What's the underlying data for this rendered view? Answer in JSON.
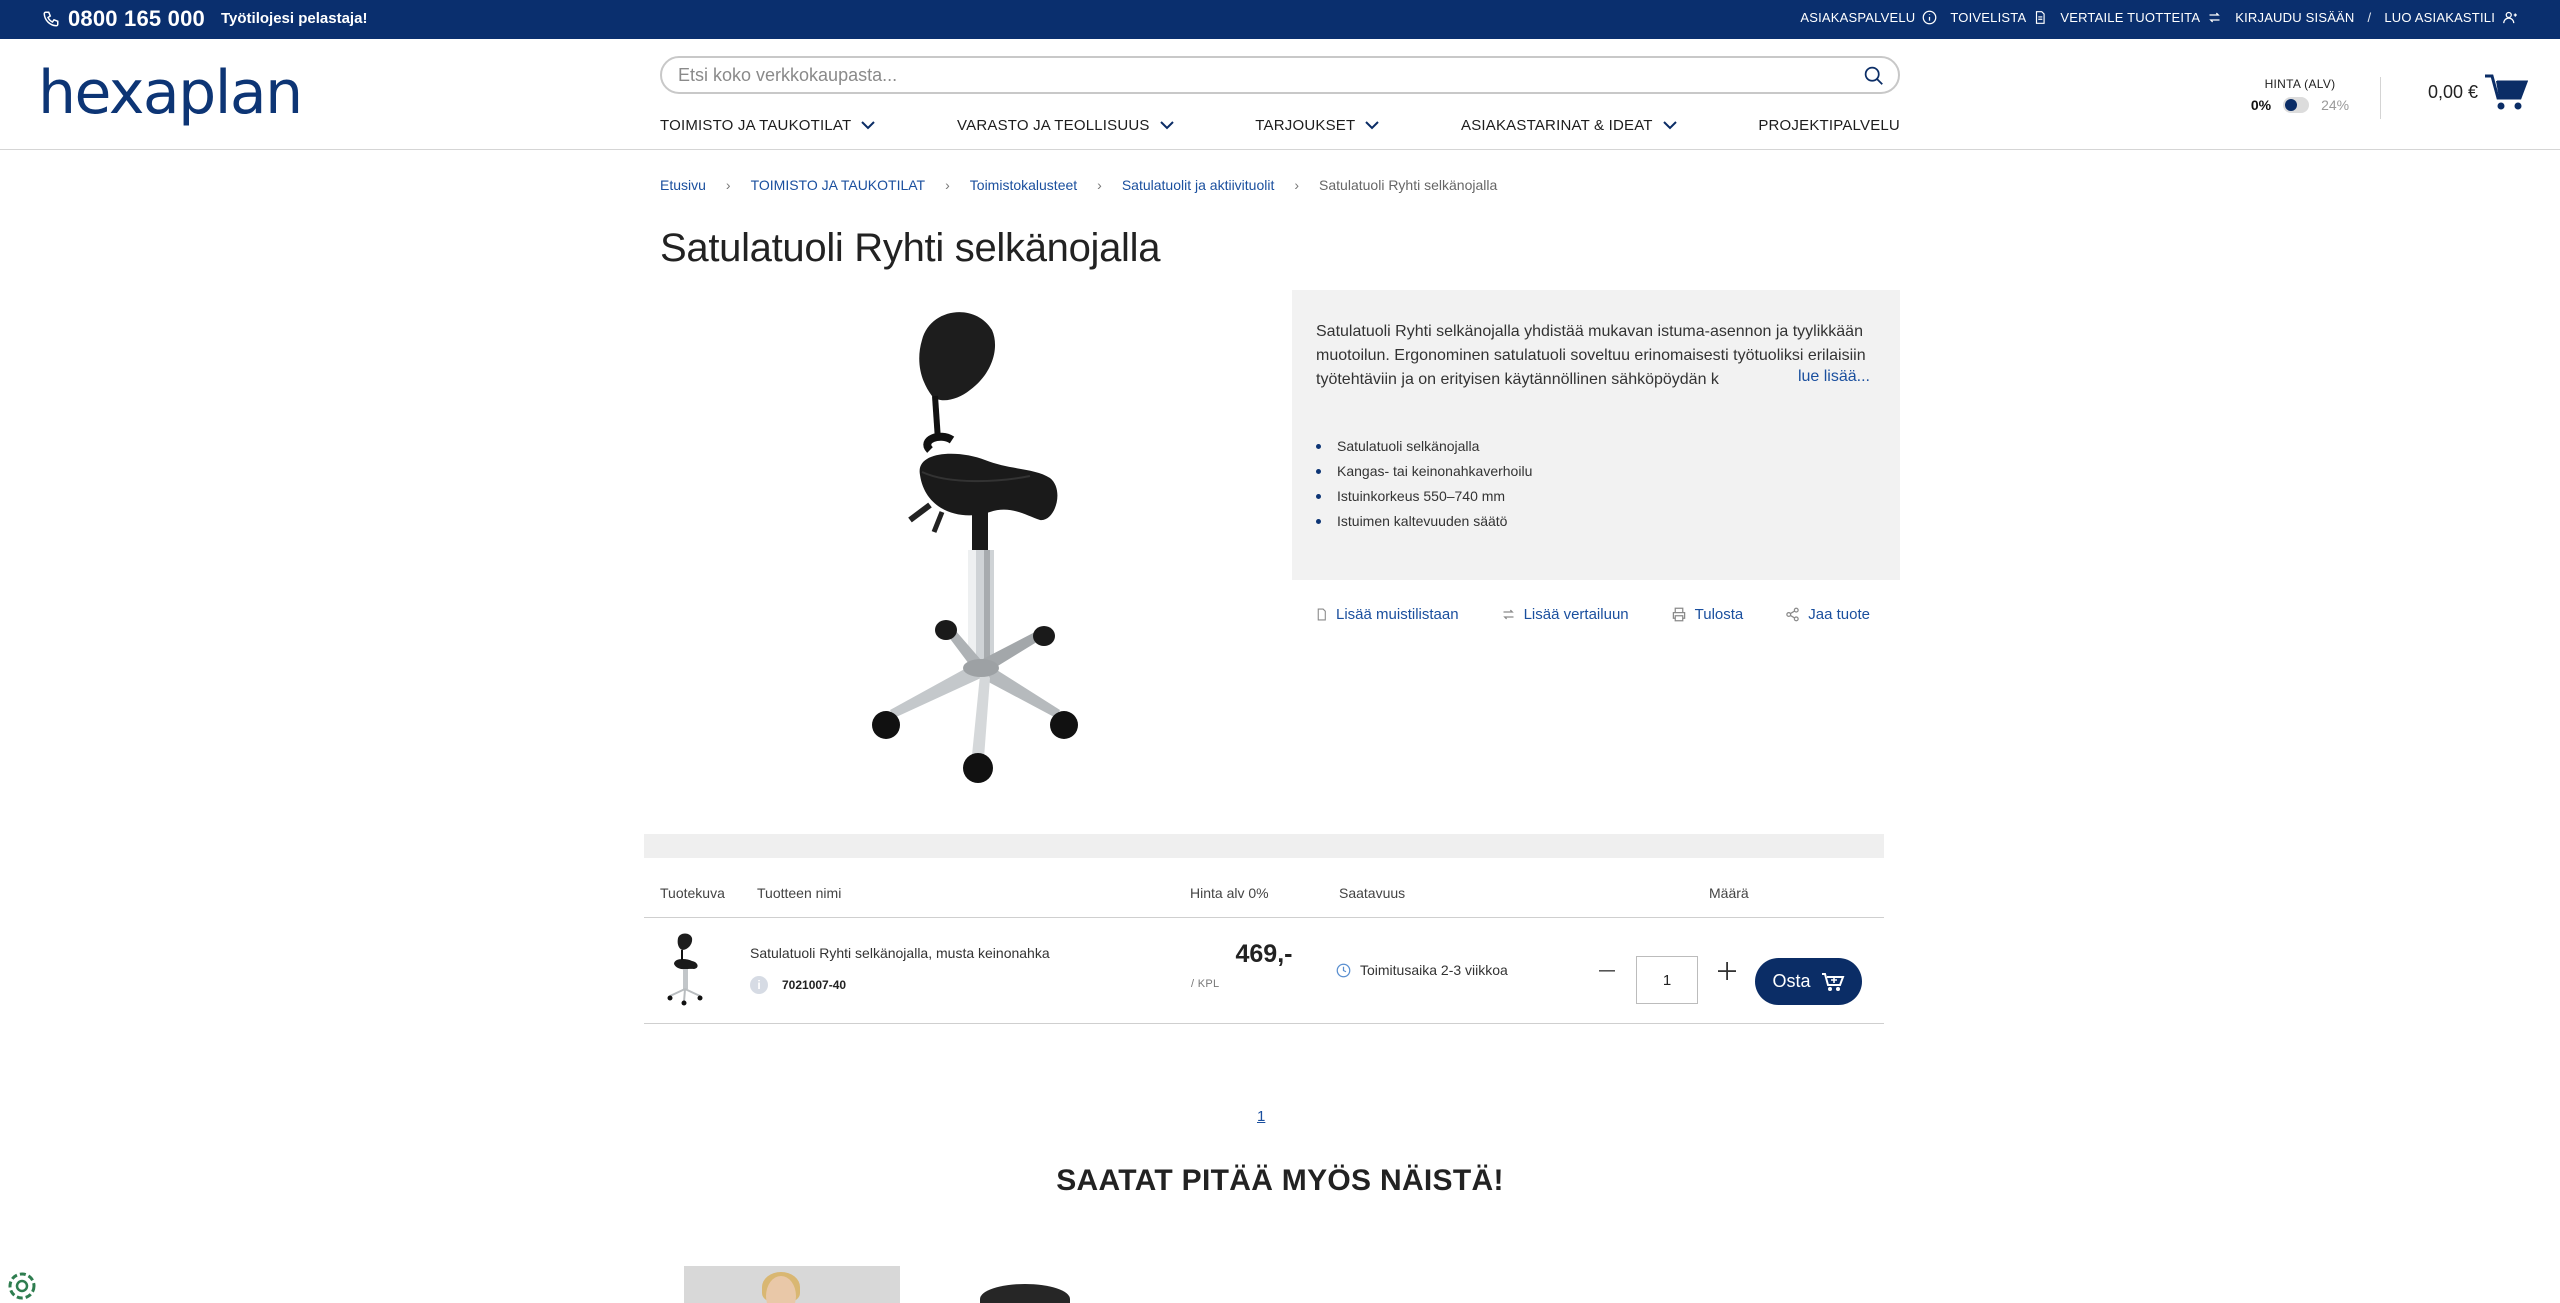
{
  "topbar": {
    "phone": "0800 165 000",
    "tagline": "Työtilojesi pelastaja!",
    "links": {
      "customer_service": "ASIAKASPALVELU",
      "wishlist": "TOIVELISTA",
      "compare": "VERTAILE TUOTTEITA",
      "login": "KIRJAUDU SISÄÄN",
      "separator": "/",
      "register": "LUO ASIAKASTILI"
    }
  },
  "header": {
    "logo": "hexaplan",
    "search_placeholder": "Etsi koko verkkokaupasta...",
    "nav": [
      {
        "label": "TOIMISTO JA TAUKOTILAT"
      },
      {
        "label": "VARASTO JA TEOLLISUUS"
      },
      {
        "label": "TARJOUKSET"
      },
      {
        "label": "ASIAKASTARINAT & IDEAT"
      },
      {
        "label": "PROJEKTIPALVELU"
      }
    ],
    "price_toggle": {
      "label": "HINTA (ALV)",
      "left": "0%",
      "right": "24%"
    },
    "cart_total": "0,00 €"
  },
  "breadcrumb": [
    "Etusivu",
    "TOIMISTO JA TAUKOTILAT",
    "Toimistokalusteet",
    "Satulatuolit ja aktiivituolit",
    "Satulatuoli Ryhti selkänojalla"
  ],
  "product": {
    "title": "Satulatuoli Ryhti selkänojalla",
    "description": "Satulatuoli Ryhti selkänojalla yhdistää mukavan istuma-asennon ja tyylikkään muotoilun. Ergonominen satulatuoli soveltuu erinomaisesti työtuoliksi erilaisiin työtehtäviin ja on erityisen käytännöllinen sähköpöydän k",
    "read_more": "lue lisää...",
    "bullets": [
      "Satulatuoli selkänojalla",
      "Kangas- tai keinonahkaverhoilu",
      "Istuinkorkeus 550–740 mm",
      "Istuimen kaltevuuden säätö"
    ],
    "actions": {
      "wishlist": "Lisää muistilistaan",
      "compare": "Lisää vertailuun",
      "print": "Tulosta",
      "share": "Jaa tuote"
    }
  },
  "table": {
    "headers": {
      "image": "Tuotekuva",
      "name": "Tuotteen nimi",
      "price": "Hinta alv 0%",
      "availability": "Saatavuus",
      "quantity": "Määrä"
    },
    "rows": [
      {
        "name": "Satulatuoli Ryhti selkänojalla, musta keinonahka",
        "info": "i",
        "sku": "7021007-40",
        "price": "469,-",
        "unit": "/ KPL",
        "availability": "Toimitusaika 2-3 viikkoa",
        "quantity": "1",
        "buy_label": "Osta"
      }
    ]
  },
  "pager": {
    "current": "1"
  },
  "related": {
    "title": "SAATAT PITÄÄ MYÖS NÄISTÄ!"
  },
  "colors": {
    "primary": "#0a2f6e",
    "link": "#1a4f9e",
    "panel": "#f2f2f2"
  }
}
